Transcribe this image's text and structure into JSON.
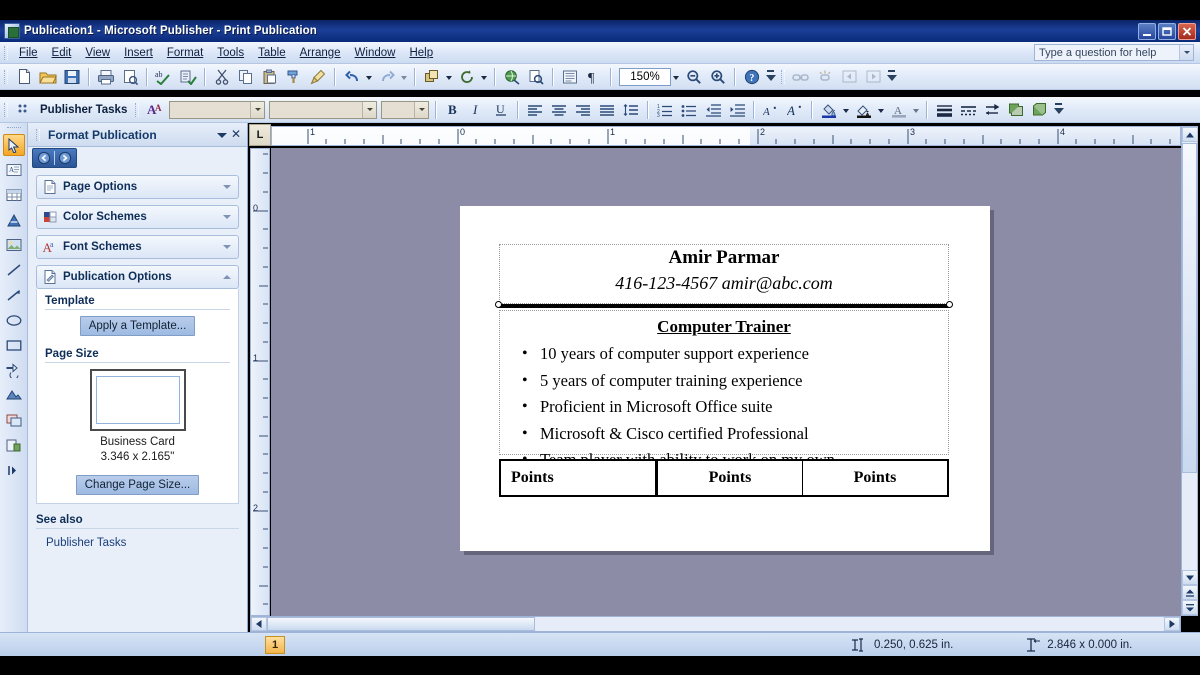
{
  "window": {
    "title": "Publication1 - Microsoft Publisher - Print Publication",
    "app_icon": "publisher-icon",
    "minimize_label": "_",
    "restore_label": "❐",
    "close_label": "✕"
  },
  "menubar": {
    "items": [
      {
        "label": "File"
      },
      {
        "label": "Edit"
      },
      {
        "label": "View"
      },
      {
        "label": "Insert"
      },
      {
        "label": "Format"
      },
      {
        "label": "Tools"
      },
      {
        "label": "Table"
      },
      {
        "label": "Arrange"
      },
      {
        "label": "Window"
      },
      {
        "label": "Help"
      }
    ],
    "help_box": {
      "placeholder": "Type a question for help",
      "value": ""
    }
  },
  "standard_toolbar": {
    "zoom_value": "150%",
    "buttons": [
      {
        "name": "new-publication-icon",
        "title": "New"
      },
      {
        "name": "open-folder-icon",
        "title": "Open"
      },
      {
        "name": "save-icon",
        "title": "Save"
      },
      {
        "name": "print-icon",
        "title": "Print"
      },
      {
        "name": "print-preview-icon",
        "title": "Print Preview"
      },
      {
        "name": "spelling-check-icon",
        "title": "Spelling"
      },
      {
        "name": "design-checker-icon",
        "title": "Design Checker"
      },
      {
        "name": "cut-scissors-icon",
        "title": "Cut"
      },
      {
        "name": "copy-icon",
        "title": "Copy"
      },
      {
        "name": "paste-icon",
        "title": "Paste"
      },
      {
        "name": "format-painter-icon",
        "title": "Format Painter"
      },
      {
        "name": "brush-icon",
        "title": "Pick up Formatting"
      },
      {
        "name": "undo-icon",
        "title": "Undo"
      },
      {
        "name": "redo-icon",
        "title": "Redo"
      },
      {
        "name": "bring-to-front-icon",
        "title": "Bring to Front"
      },
      {
        "name": "rotate-icon",
        "title": "Rotate"
      },
      {
        "name": "insert-hyperlink-icon",
        "title": "Insert Hyperlink"
      },
      {
        "name": "find-icon",
        "title": "Find"
      },
      {
        "name": "special-characters-icon",
        "title": "Special Characters"
      },
      {
        "name": "paragraph-marks-icon",
        "title": "Show Formatting Marks"
      },
      {
        "name": "zoom-out-icon",
        "title": "Zoom Out"
      },
      {
        "name": "zoom-in-icon",
        "title": "Zoom In"
      },
      {
        "name": "help-icon",
        "title": "Microsoft Publisher Help"
      }
    ]
  },
  "formatting_toolbar": {
    "publisher_tasks_label": "Publisher Tasks",
    "styles_value": "",
    "font_value": "",
    "size_value": "",
    "buttons": [
      {
        "name": "styles-and-formatting-icon",
        "title": "Styles and Formatting"
      },
      {
        "name": "bold-button",
        "label": "B"
      },
      {
        "name": "italic-button",
        "label": "I"
      },
      {
        "name": "underline-button",
        "label": "U"
      },
      {
        "name": "align-left-button",
        "label": ""
      },
      {
        "name": "align-center-button",
        "label": ""
      },
      {
        "name": "align-right-button",
        "label": ""
      },
      {
        "name": "align-justify-button",
        "label": ""
      },
      {
        "name": "line-spacing-button",
        "label": ""
      },
      {
        "name": "numbered-list-button",
        "label": ""
      },
      {
        "name": "bulleted-list-button",
        "label": ""
      },
      {
        "name": "decrease-indent-button",
        "label": ""
      },
      {
        "name": "increase-indent-button",
        "label": ""
      },
      {
        "name": "decrease-font-size-button",
        "label": "A"
      },
      {
        "name": "increase-font-size-button",
        "label": "A"
      },
      {
        "name": "fill-color-button",
        "label": ""
      },
      {
        "name": "line-color-button",
        "label": ""
      },
      {
        "name": "font-color-button",
        "label": "A"
      },
      {
        "name": "line-weight-button",
        "label": ""
      },
      {
        "name": "dash-style-button",
        "label": ""
      },
      {
        "name": "arrow-style-button",
        "label": ""
      },
      {
        "name": "shadow-style-button",
        "label": ""
      },
      {
        "name": "3d-style-button",
        "label": ""
      }
    ]
  },
  "objects_toolbar": {
    "items": [
      {
        "name": "select-objects-tool",
        "label": "Select Objects",
        "selected": true
      },
      {
        "name": "text-box-tool",
        "label": "Text Box",
        "selected": false
      },
      {
        "name": "insert-table-tool",
        "label": "Insert Table",
        "selected": false
      },
      {
        "name": "insert-wordart-tool",
        "label": "Insert WordArt",
        "selected": false
      },
      {
        "name": "picture-frame-tool",
        "label": "Picture Frame",
        "selected": false
      },
      {
        "name": "line-tool",
        "label": "Line",
        "selected": false
      },
      {
        "name": "arrow-tool",
        "label": "Arrow",
        "selected": false
      },
      {
        "name": "oval-tool",
        "label": "Oval",
        "selected": false
      },
      {
        "name": "rectangle-tool",
        "label": "Rectangle",
        "selected": false
      },
      {
        "name": "autoshapes-tool",
        "label": "AutoShapes",
        "selected": false
      },
      {
        "name": "design-gallery-tool",
        "label": "Design Gallery Object",
        "selected": false
      },
      {
        "name": "item-from-content-library-tool",
        "label": "Item from Content Library",
        "selected": false
      },
      {
        "name": "insert-object-tool",
        "label": "Insert Object",
        "selected": false
      },
      {
        "name": "toolbar-expand-tool",
        "label": "Toolbar Options",
        "selected": false
      }
    ]
  },
  "task_pane": {
    "title": "Format Publication",
    "caret_icon": "chevron-down-icon",
    "close_icon": "close-icon",
    "nav": {
      "back_icon": "back-arrow-icon",
      "forward_icon": "forward-arrow-icon"
    },
    "sections": [
      {
        "name": "page-options",
        "label": "Page Options",
        "icon": "page-icon",
        "expanded": false
      },
      {
        "name": "color-schemes",
        "label": "Color Schemes",
        "icon": "color-swatch-icon",
        "expanded": false
      },
      {
        "name": "font-schemes",
        "label": "Font Schemes",
        "icon": "font-scheme-icon",
        "expanded": false
      },
      {
        "name": "publication-options",
        "label": "Publication Options",
        "icon": "publication-icon",
        "expanded": true
      }
    ],
    "publication_options": {
      "template_heading": "Template",
      "apply_template_button": "Apply a Template...",
      "page_size_heading": "Page Size",
      "page_size_name": "Business Card",
      "page_size_dims": "3.346 x 2.165\"",
      "change_page_size_button": "Change Page Size..."
    },
    "see_also": {
      "heading": "See also",
      "links": [
        {
          "label": "Publisher Tasks"
        }
      ]
    },
    "footer_icon": "chevron-down-icon"
  },
  "rulers": {
    "corner_label": "L",
    "horizontal_labels": [
      "1",
      "0",
      "1",
      "2",
      "3",
      "4"
    ],
    "vertical_labels": [
      "0",
      "1",
      "2"
    ],
    "units": "in."
  },
  "document": {
    "name": "Amir Parmar",
    "contact": "416-123-4567 amir@abc.com",
    "role": "Computer Trainer",
    "bullets": [
      "10 years of computer support experience",
      "5 years of computer training experience",
      "Proficient in Microsoft Office suite",
      "Microsoft & Cisco certified Professional",
      "Team player with ability to work on my own"
    ],
    "table_row": [
      "Points",
      "Points",
      "Points"
    ]
  },
  "status_bar": {
    "page_number": "1",
    "position_icon": "position-crosshair-icon",
    "position": "0.250, 0.625 in.",
    "size_icon": "object-size-icon",
    "size": "2.846 x  0.000 in."
  },
  "colors": {
    "titlebar_start": "#0a246a",
    "titlebar_end": "#1c3f97",
    "toolbar_bg": "#dce7f8",
    "task_pane_bg": "#e8eff9",
    "canvas_bg": "#8c8ca6",
    "accent_blue": "#2a5596",
    "page_badge": "#f2b44c",
    "cursor_highlight": "#fff282"
  }
}
